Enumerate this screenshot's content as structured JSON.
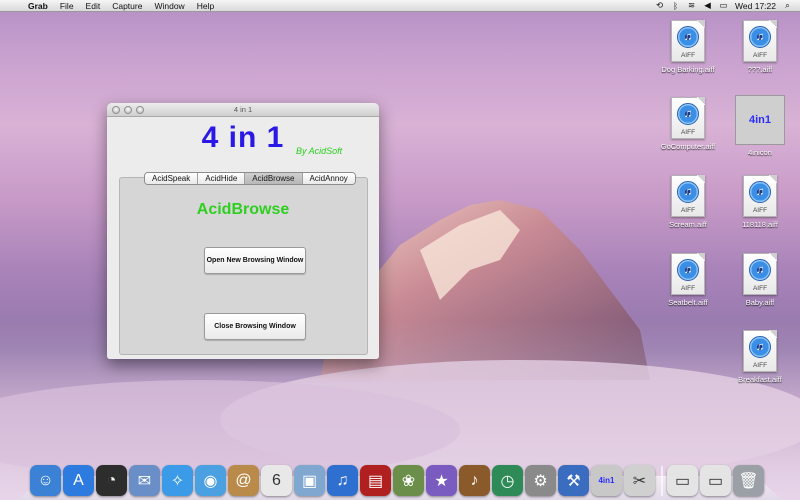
{
  "menubar": {
    "app_name": "Grab",
    "menus": [
      "File",
      "Edit",
      "Capture",
      "Window",
      "Help"
    ],
    "clock": "Wed 17:22"
  },
  "desktop_icons": [
    {
      "label": "Dog Barking.aiff",
      "type": "AIFF"
    },
    {
      "label": "???.aiff",
      "type": "AIFF"
    },
    {
      "label": "GoComputer.aiff",
      "type": "AIFF"
    },
    {
      "label": "4inicon",
      "thumb_text": "4in1"
    },
    {
      "label": "Scream.aiff",
      "type": "AIFF"
    },
    {
      "label": "118118.aiff",
      "type": "AIFF"
    },
    {
      "label": "Seatbelt.aiff",
      "type": "AIFF"
    },
    {
      "label": "Baby.aiff",
      "type": "AIFF"
    },
    {
      "label": "Breakfast.aiff",
      "type": "AIFF"
    }
  ],
  "window": {
    "title": "4 in 1",
    "app_title": "4 in 1",
    "byline": "By AcidSoft",
    "tabs": [
      "AcidSpeak",
      "AcidHide",
      "AcidBrowse",
      "AcidAnnoy"
    ],
    "active_tab": "AcidBrowse",
    "heading": "AcidBrowse",
    "buttons": {
      "open": "Open New Browsing Window",
      "close": "Close Browsing Window"
    }
  },
  "dock": {
    "items": [
      {
        "name": "finder",
        "glyph": "☺",
        "color": "#3b82d6"
      },
      {
        "name": "app-store",
        "glyph": "A",
        "color": "#2e7be0"
      },
      {
        "name": "dashboard",
        "glyph": "◔",
        "color": "#2d2d2d"
      },
      {
        "name": "mail",
        "glyph": "✉",
        "color": "#6a8fc8"
      },
      {
        "name": "safari",
        "glyph": "✧",
        "color": "#3b9be8"
      },
      {
        "name": "facetime",
        "glyph": "◉",
        "color": "#4aa0e0"
      },
      {
        "name": "address-book",
        "glyph": "@",
        "color": "#b98a4a"
      },
      {
        "name": "ical",
        "glyph": "6",
        "color": "#e8e8e8"
      },
      {
        "name": "preview",
        "glyph": "▣",
        "color": "#7fa7d0"
      },
      {
        "name": "itunes",
        "glyph": "♫",
        "color": "#2f6fd0"
      },
      {
        "name": "photo-booth",
        "glyph": "▤",
        "color": "#b02020"
      },
      {
        "name": "iphoto",
        "glyph": "❀",
        "color": "#6b8f4a"
      },
      {
        "name": "imovie",
        "glyph": "★",
        "color": "#7a5cc0"
      },
      {
        "name": "garageband",
        "glyph": "♪",
        "color": "#8a5a2a"
      },
      {
        "name": "time-machine",
        "glyph": "◷",
        "color": "#2e8b57"
      },
      {
        "name": "system-preferences",
        "glyph": "⚙",
        "color": "#8a8a8a"
      },
      {
        "name": "xcode",
        "glyph": "⚒",
        "color": "#3a6cc0"
      },
      {
        "name": "4in1",
        "glyph": "4in1",
        "color": "#c8c8c8"
      },
      {
        "name": "grab",
        "glyph": "✂",
        "color": "#d0d0d0"
      },
      {
        "name": "documents",
        "glyph": "▭",
        "color": "#e4e4e4"
      },
      {
        "name": "downloads",
        "glyph": "▭",
        "color": "#e4e4e4"
      },
      {
        "name": "trash",
        "glyph": "🗑",
        "color": "#9aa0a6"
      }
    ]
  }
}
